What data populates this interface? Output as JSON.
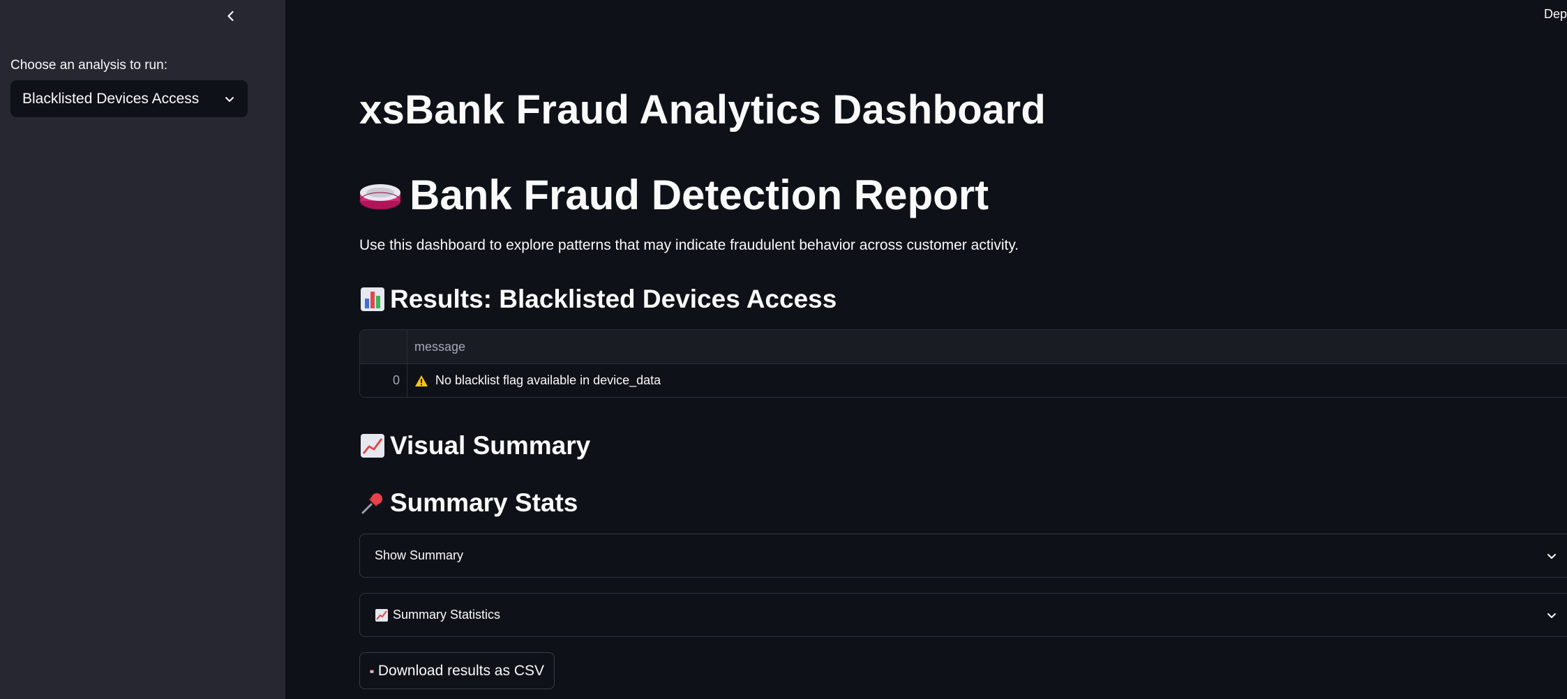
{
  "topbar": {
    "deploy_label": "Dep"
  },
  "sidebar": {
    "collapse_icon": "chevron-left-icon",
    "select_label": "Choose an analysis to run:",
    "select_value": "Blacklisted Devices Access"
  },
  "main": {
    "title": "xsBank Fraud Analytics Dashboard",
    "report_heading": "Bank Fraud Detection Report",
    "intro_text": "Use this dashboard to explore patterns that may indicate fraudulent behavior across customer activity.",
    "results_heading": "Results: Blacklisted Devices Access",
    "table": {
      "columns": [
        "",
        "message"
      ],
      "rows": [
        {
          "index": "0",
          "message": "No blacklist flag available in device_data"
        }
      ]
    },
    "visual_heading": "Visual Summary",
    "stats_heading": "Summary Stats",
    "expanders": [
      {
        "label": "Show Summary"
      },
      {
        "label": "Summary Statistics"
      }
    ],
    "download_label": "Download results as CSV"
  },
  "colors": {
    "background": "#0e1117",
    "sidebar": "#262730",
    "text": "#fafafa",
    "muted": "#a3a8b8",
    "border": "#33363f"
  }
}
